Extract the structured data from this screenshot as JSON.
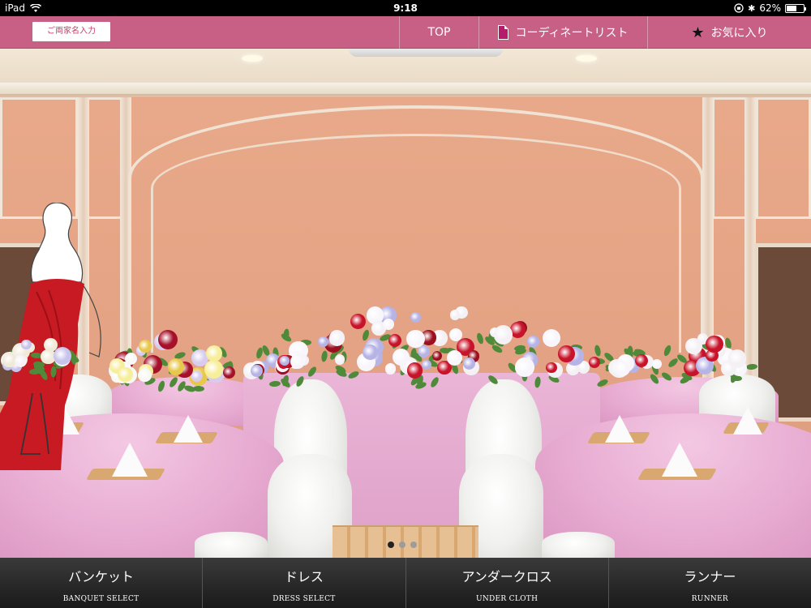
{
  "statusbar": {
    "device": "iPad",
    "time": "9:18",
    "battery": "62%",
    "battery_level": 0.62
  },
  "topnav": {
    "name_button": "ご両家名入力",
    "top": "TOP",
    "coordinate_list": "コーディネートリスト",
    "favorites": "お気に入り"
  },
  "pager": {
    "pages": 3,
    "current": 1
  },
  "bottom_menu": [
    {
      "label": "バンケット",
      "sub": "BANQUET SELECT"
    },
    {
      "label": "ドレス",
      "sub": "DRESS SELECT"
    },
    {
      "label": "アンダークロス",
      "sub": "UNDER CLOTH"
    },
    {
      "label": "ランナー",
      "sub": "RUNNER"
    }
  ],
  "colors": {
    "nav_bar": "#c85f85",
    "table_cloth": "#e8acd2",
    "dress": "#c81a22"
  }
}
